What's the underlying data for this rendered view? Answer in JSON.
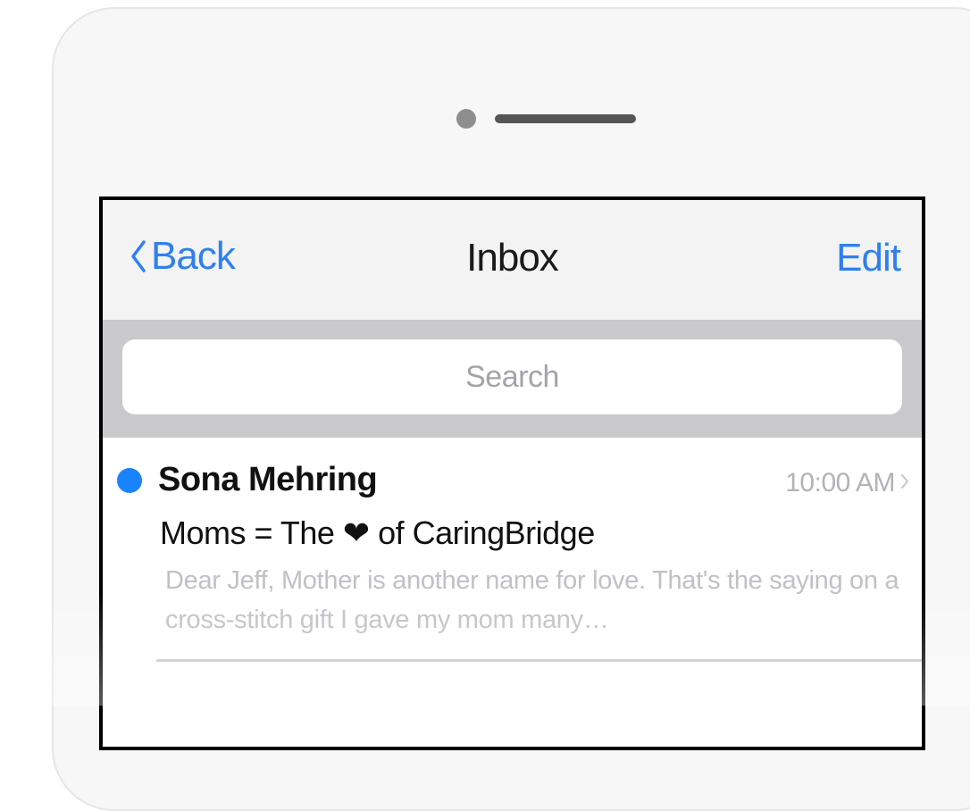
{
  "navbar": {
    "back_label": "Back",
    "title": "Inbox",
    "edit_label": "Edit"
  },
  "search": {
    "placeholder": "Search"
  },
  "messages": [
    {
      "sender": "Sona Mehring",
      "time": "10:00 AM",
      "subject": "Moms = The ❤ of CaringBridge",
      "preview": "Dear Jeff, Mother is another name for love. That's the saying on a cross-stitch gift I gave my mom many…",
      "unread": true
    }
  ],
  "colors": {
    "accent": "#2f80ed",
    "unread_dot": "#1a84ff",
    "search_bar_bg": "#c9c9cb",
    "navbar_bg": "#f3f3f3"
  },
  "icons": {
    "back": "chevron-left-icon",
    "disclosure": "chevron-right-icon"
  }
}
